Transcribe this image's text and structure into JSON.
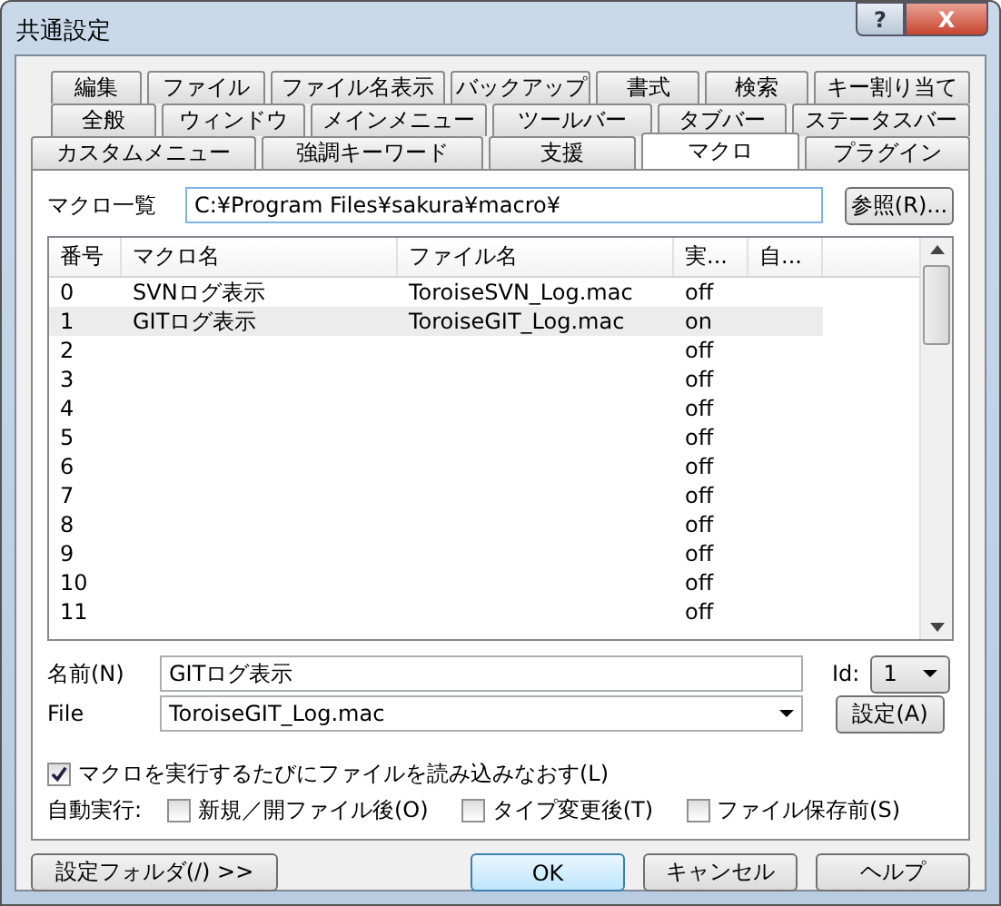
{
  "window": {
    "title": "共通設定",
    "help_button": "?",
    "close_button": "X"
  },
  "tab_rows": [
    [
      {
        "label": "編集",
        "selected": false
      },
      {
        "label": "ファイル",
        "selected": false
      },
      {
        "label": "ファイル名表示",
        "selected": false
      },
      {
        "label": "バックアップ",
        "selected": false
      },
      {
        "label": "書式",
        "selected": false
      },
      {
        "label": "検索",
        "selected": false
      },
      {
        "label": "キー割り当て",
        "selected": false
      }
    ],
    [
      {
        "label": "全般",
        "selected": false
      },
      {
        "label": "ウィンドウ",
        "selected": false
      },
      {
        "label": "メインメニュー",
        "selected": false
      },
      {
        "label": "ツールバー",
        "selected": false
      },
      {
        "label": "タブバー",
        "selected": false
      },
      {
        "label": "ステータスバー",
        "selected": false
      }
    ],
    [
      {
        "label": "カスタムメニュー",
        "selected": false
      },
      {
        "label": "強調キーワード",
        "selected": false
      },
      {
        "label": "支援",
        "selected": false
      },
      {
        "label": "マクロ",
        "selected": true
      },
      {
        "label": "プラグイン",
        "selected": false
      }
    ]
  ],
  "macro_list": {
    "label": "マクロ一覧",
    "path": "C:¥Program Files¥sakura¥macro¥",
    "browse_button": "参照(R)..."
  },
  "table": {
    "columns": [
      "番号",
      "マクロ名",
      "ファイル名",
      "実...",
      "自..."
    ],
    "rows": [
      {
        "number": "0",
        "name": "SVNログ表示",
        "file": "ToroiseSVN_Log.mac",
        "exec": "off",
        "selected": false
      },
      {
        "number": "1",
        "name": "GITログ表示",
        "file": "ToroiseGIT_Log.mac",
        "exec": "on",
        "selected": true
      },
      {
        "number": "2",
        "exec": "off",
        "selected": false
      },
      {
        "number": "3",
        "exec": "off",
        "selected": false
      },
      {
        "number": "4",
        "exec": "off",
        "selected": false
      },
      {
        "number": "5",
        "exec": "off",
        "selected": false
      },
      {
        "number": "6",
        "exec": "off",
        "selected": false
      },
      {
        "number": "7",
        "exec": "off",
        "selected": false
      },
      {
        "number": "8",
        "exec": "off",
        "selected": false
      },
      {
        "number": "9",
        "exec": "off",
        "selected": false
      },
      {
        "number": "10",
        "exec": "off",
        "selected": false
      },
      {
        "number": "11",
        "exec": "off",
        "selected": false
      }
    ]
  },
  "name_field": {
    "label": "名前(N)",
    "value": "GITログ表示"
  },
  "file_field": {
    "label": "File",
    "value": "ToroiseGIT_Log.mac"
  },
  "id_field": {
    "label": "Id:",
    "value": "1"
  },
  "set_button": "設定(A)",
  "reload_checkbox": {
    "label": "マクロを実行するたびにファイルを読み込みなおす(L)",
    "checked": true
  },
  "auto_exec": {
    "label": "自動実行:",
    "options": [
      {
        "label": "新規／開ファイル後(O)",
        "checked": false
      },
      {
        "label": "タイプ変更後(T)",
        "checked": false
      },
      {
        "label": "ファイル保存前(S)",
        "checked": false
      }
    ]
  },
  "buttons": [
    {
      "label": "設定フォルダ(/) >>",
      "kind": "folder"
    },
    {
      "label": "OK",
      "kind": "default"
    },
    {
      "label": "キャンセル",
      "kind": "normal"
    },
    {
      "label": "ヘルプ",
      "kind": "normal"
    }
  ]
}
